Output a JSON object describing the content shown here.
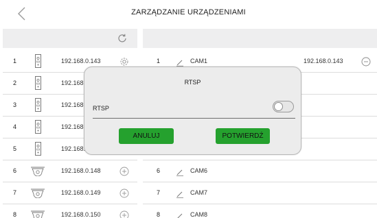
{
  "header": {
    "title": "ZARZĄDZANIE URZĄDZENIAMI"
  },
  "devices": [
    {
      "num": "1",
      "ip": "192.168.0.143",
      "type": "intercom",
      "action": "settings-icon"
    },
    {
      "num": "2",
      "ip": "192.168.",
      "type": "intercom",
      "action": ""
    },
    {
      "num": "3",
      "ip": "192.168.",
      "type": "intercom",
      "action": ""
    },
    {
      "num": "4",
      "ip": "192.168.",
      "type": "intercom",
      "action": ""
    },
    {
      "num": "5",
      "ip": "192.168.",
      "type": "intercom",
      "action": ""
    },
    {
      "num": "6",
      "ip": "192.168.0.148",
      "type": "dome-camera",
      "action": "plus-icon"
    },
    {
      "num": "7",
      "ip": "192.168.0.149",
      "type": "dome-camera",
      "action": "plus-icon"
    },
    {
      "num": "8",
      "ip": "192.168.0.150",
      "type": "dome-camera",
      "action": "plus-icon"
    }
  ],
  "cameras": [
    {
      "num": "1",
      "name": "CAM1",
      "ip": "192.168.0.143"
    },
    {
      "num": "6",
      "name": "CAM6",
      "ip": ""
    },
    {
      "num": "7",
      "name": "CAM7",
      "ip": ""
    },
    {
      "num": "8",
      "name": "CAM8",
      "ip": ""
    }
  ],
  "modal": {
    "title": "RTSP",
    "toggle_label": "RTSP",
    "toggle_on": false,
    "cancel_label": "ANULUJ",
    "confirm_label": "POTWIERDŹ"
  },
  "colors": {
    "button_green": "#25a12e",
    "header_bg": "#eeeeef",
    "divider": "#dcdcdc"
  }
}
